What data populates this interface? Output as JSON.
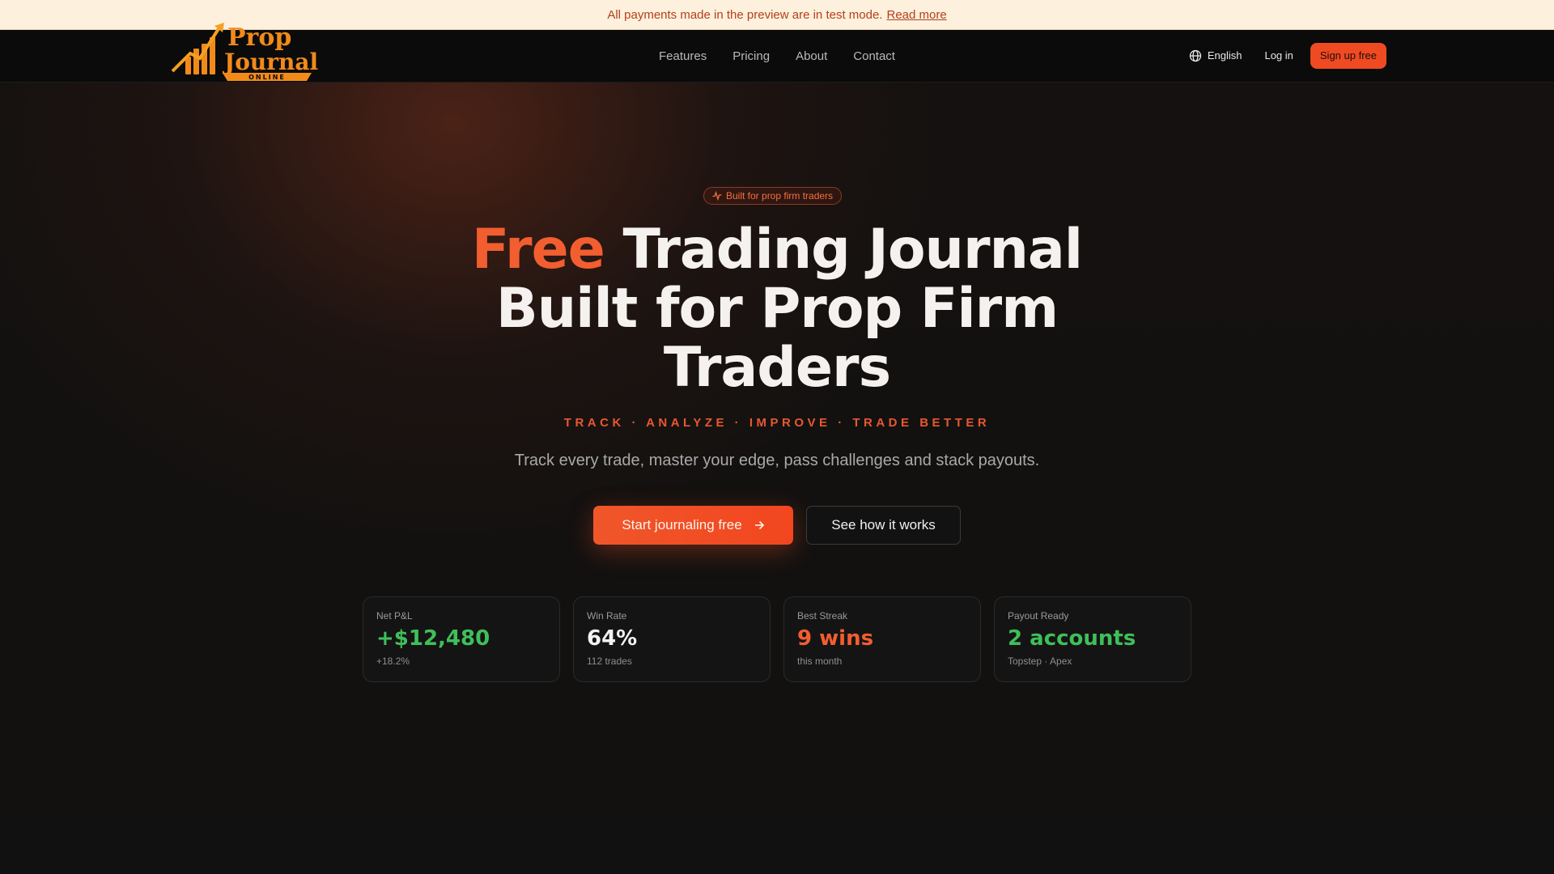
{
  "banner": {
    "text": "All payments made in the preview are in test mode.",
    "link": "Read more"
  },
  "logo": {
    "line1": "Prop",
    "line2": "Journal",
    "ribbon": "ONLINE"
  },
  "nav": {
    "links": [
      "Features",
      "Pricing",
      "About",
      "Contact"
    ],
    "language": "English",
    "login": "Log in",
    "signup": "Sign up free"
  },
  "hero": {
    "pill": "Built for prop firm traders",
    "headline_accent": "Free",
    "headline_line1_rest": " Trading Journal",
    "headline_line2": "Built for Prop Firm",
    "headline_line3": "Traders",
    "tagline": "TRACK · ANALYZE · IMPROVE · TRADE BETTER",
    "subtitle": "Track every trade, master your edge, pass challenges and stack payouts.",
    "cta_primary": "Start journaling free",
    "cta_secondary": "See how it works"
  },
  "stats": [
    {
      "label": "Net P&L",
      "value": "+$12,480",
      "note": "+18.2%",
      "color": "#3fbf5a"
    },
    {
      "label": "Win Rate",
      "value": "64%",
      "note": "112 trades",
      "color": "#f2f2f2"
    },
    {
      "label": "Best Streak",
      "value": "9 wins",
      "note": "this month",
      "color": "#f25e30"
    },
    {
      "label": "Payout Ready",
      "value": "2 accounts",
      "note": "Topstep · Apex",
      "color": "#3fbf5a"
    }
  ],
  "colors": {
    "accent": "#f25e30",
    "banner_bg": "#fdf0dc",
    "background": "#0f0f0f",
    "positive": "#3fbf5a"
  },
  "icons": {
    "language": "globe-icon",
    "pill": "activity-icon",
    "cta": "arrow-right-icon"
  }
}
